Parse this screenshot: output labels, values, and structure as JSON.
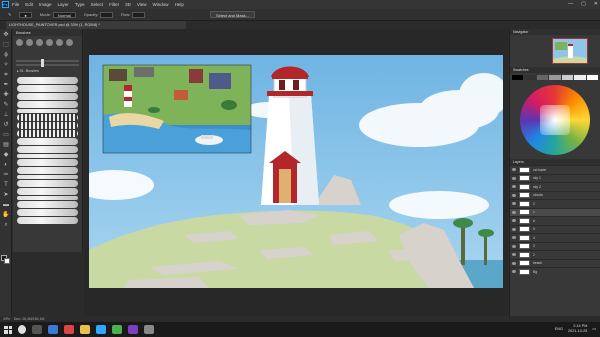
{
  "menubar": {
    "logo": "Ps",
    "items": [
      "File",
      "Edit",
      "Image",
      "Layer",
      "Type",
      "Select",
      "Filter",
      "3D",
      "View",
      "Window",
      "Help"
    ],
    "win_controls": [
      "—",
      "▢",
      "✕"
    ]
  },
  "options": {
    "mode_label": "Mode:",
    "mode_value": "Normal",
    "opacity_label": "Opacity:",
    "flow_label": "Flow:",
    "select_button": "Select and Mask..."
  },
  "document": {
    "tab_title": "LIGHTHOUSE_PAINTOVER.psd @ 33% (1, RGB/8) *"
  },
  "panels": {
    "brushes_title": "Brushes",
    "brush_folder": "▸ 01. Brushes",
    "navigator_title": "Navigator",
    "swatches_title": "Swatches",
    "layers_title": "Layers"
  },
  "layers": [
    {
      "name": "cel lower"
    },
    {
      "name": "sky 1"
    },
    {
      "name": "sky 2"
    },
    {
      "name": "clouds"
    },
    {
      "name": "2"
    },
    {
      "name": "1"
    },
    {
      "name": "6"
    },
    {
      "name": "5"
    },
    {
      "name": "4"
    },
    {
      "name": "3"
    },
    {
      "name": "2"
    },
    {
      "name": "beach"
    },
    {
      "name": "Bg"
    }
  ],
  "status": {
    "zoom": "33%",
    "doc_size": "Doc: 26,4M/184,1M"
  },
  "taskbar": {
    "time": "2:14 PM",
    "date": "2021-10-25",
    "lang": "ENG"
  },
  "colors": {
    "sky": "#8ec6ea",
    "lighthouse_red": "#b3262a",
    "hill_green": "#c8d9a4",
    "rock": "#d7d2cc"
  }
}
